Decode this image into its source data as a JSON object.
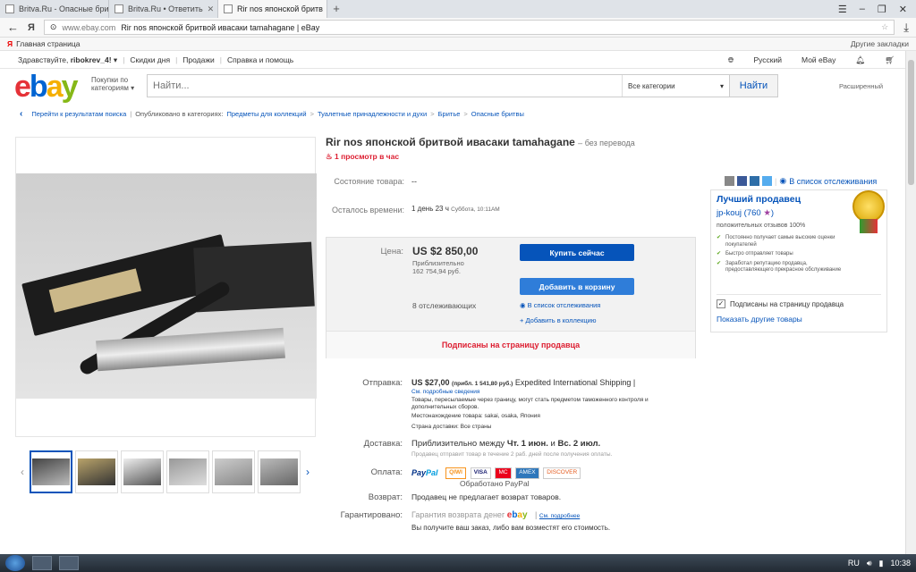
{
  "browser": {
    "tabs": [
      {
        "label": "Britva.Ru - Опасные бритвы"
      },
      {
        "label": "Britva.Ru • Ответить"
      },
      {
        "label": "Rir nos японской бритв"
      }
    ],
    "url_domain": "www.ebay.com",
    "url_title": "Rir nos японской бритвой ивасаки tamahagane | eBay",
    "yandex_label": "Я",
    "bookmark_home": "Главная страница",
    "bookmark_other": "Другие закладки"
  },
  "topnav": {
    "greeting": "Здравствуйте,",
    "username": "ribokrev_4!",
    "daily_deals": "Скидки дня",
    "sell": "Продажи",
    "help": "Справка и помощь",
    "language": "Русский",
    "my_ebay": "Мой eBay"
  },
  "header": {
    "shop_by_category": "Покупки по категориям",
    "search_placeholder": "Найти...",
    "all_categories": "Все категории",
    "search_button": "Найти",
    "advanced": "Расширенный"
  },
  "breadcrumb": {
    "back": "Перейти к результатам поиска",
    "published_in": "Опубликовано в категориях:",
    "items": [
      "Предметы для коллекций",
      "Туалетные принадлежности и духи",
      "Бритье",
      "Опасные бритвы"
    ]
  },
  "item": {
    "title": "Rir nos японской бритвой ивасаки tamahagane",
    "no_translation": "без перевода",
    "views": "1 просмотр в час",
    "watchlist": "В список отслеживания",
    "condition_label": "Состояние товара:",
    "condition_value": "--",
    "time_left_label": "Осталось времени:",
    "time_left_value": "1 день 23 ч",
    "time_left_date": "Суббота, 10:11AM",
    "price_label": "Цена:",
    "price": "US $2 850,00",
    "approx_label": "Приблизительно",
    "approx_value": "162 754,94 руб.",
    "buy_now": "Купить сейчас",
    "add_to_cart": "Добавить в корзину",
    "watchers": "8 отслеживающих",
    "add_to_watchlist": "В список отслеживания",
    "add_to_collection": "Добавить в коллекцию",
    "follow_seller_bar": "Подписаны на страницу продавца"
  },
  "seller": {
    "heading": "Лучший продавец",
    "name": "jp-kouj",
    "score": "760",
    "positive": "положительных отзывов 100%",
    "points": [
      "Постоянно получает самые высокие оценки покупателей",
      "Быстро отправляет товары",
      "Заработал репутацию продавца, предоставляющего прекрасное обслуживание"
    ],
    "follow": "Подписаны на страницу продавца",
    "other_items": "Показать другие товары"
  },
  "shipping": {
    "label": "Отправка:",
    "cost": "US $27,00",
    "approx": "(прибл. 1 541,80 руб.)",
    "service": "Expedited International Shipping |",
    "see_details": "См. подробные сведения",
    "customs_note": "Товары, пересылаемые через границу, могут стать предметом таможенного контроля и дополнительных сборов.",
    "location": "Местонахождение товара: sakai, osaka, Япония",
    "ships_to": "Страна доставки: Все страны"
  },
  "delivery": {
    "label": "Доставка:",
    "prefix": "Приблизительно между",
    "from": "Чт. 1 июн.",
    "and": "и",
    "to": "Вс. 2 июл.",
    "note": "Продавец отправит товар в течение 2 раб. дней после получения оплаты."
  },
  "payments": {
    "label": "Оплата:",
    "processed": "Обработано PayPal",
    "paypal_a": "Pay",
    "paypal_b": "Pal",
    "qiwi": "QIWI",
    "visa": "VISA",
    "mc": "MC",
    "amex": "AMEX",
    "disc": "DISCOVER"
  },
  "returns": {
    "label": "Возврат:",
    "value": "Продавец не предлагает возврат товаров."
  },
  "guarantee": {
    "label": "Гарантировано:",
    "value": "Гарантия возврата денег",
    "link": "См. подробнее",
    "note": "Вы получите ваш заказ, либо вам возместят его стоимость."
  },
  "taskbar": {
    "lang": "RU",
    "time": "10:38"
  },
  "colors": {
    "ebay_blue": "#0654ba",
    "alert_red": "#dd1e31"
  }
}
